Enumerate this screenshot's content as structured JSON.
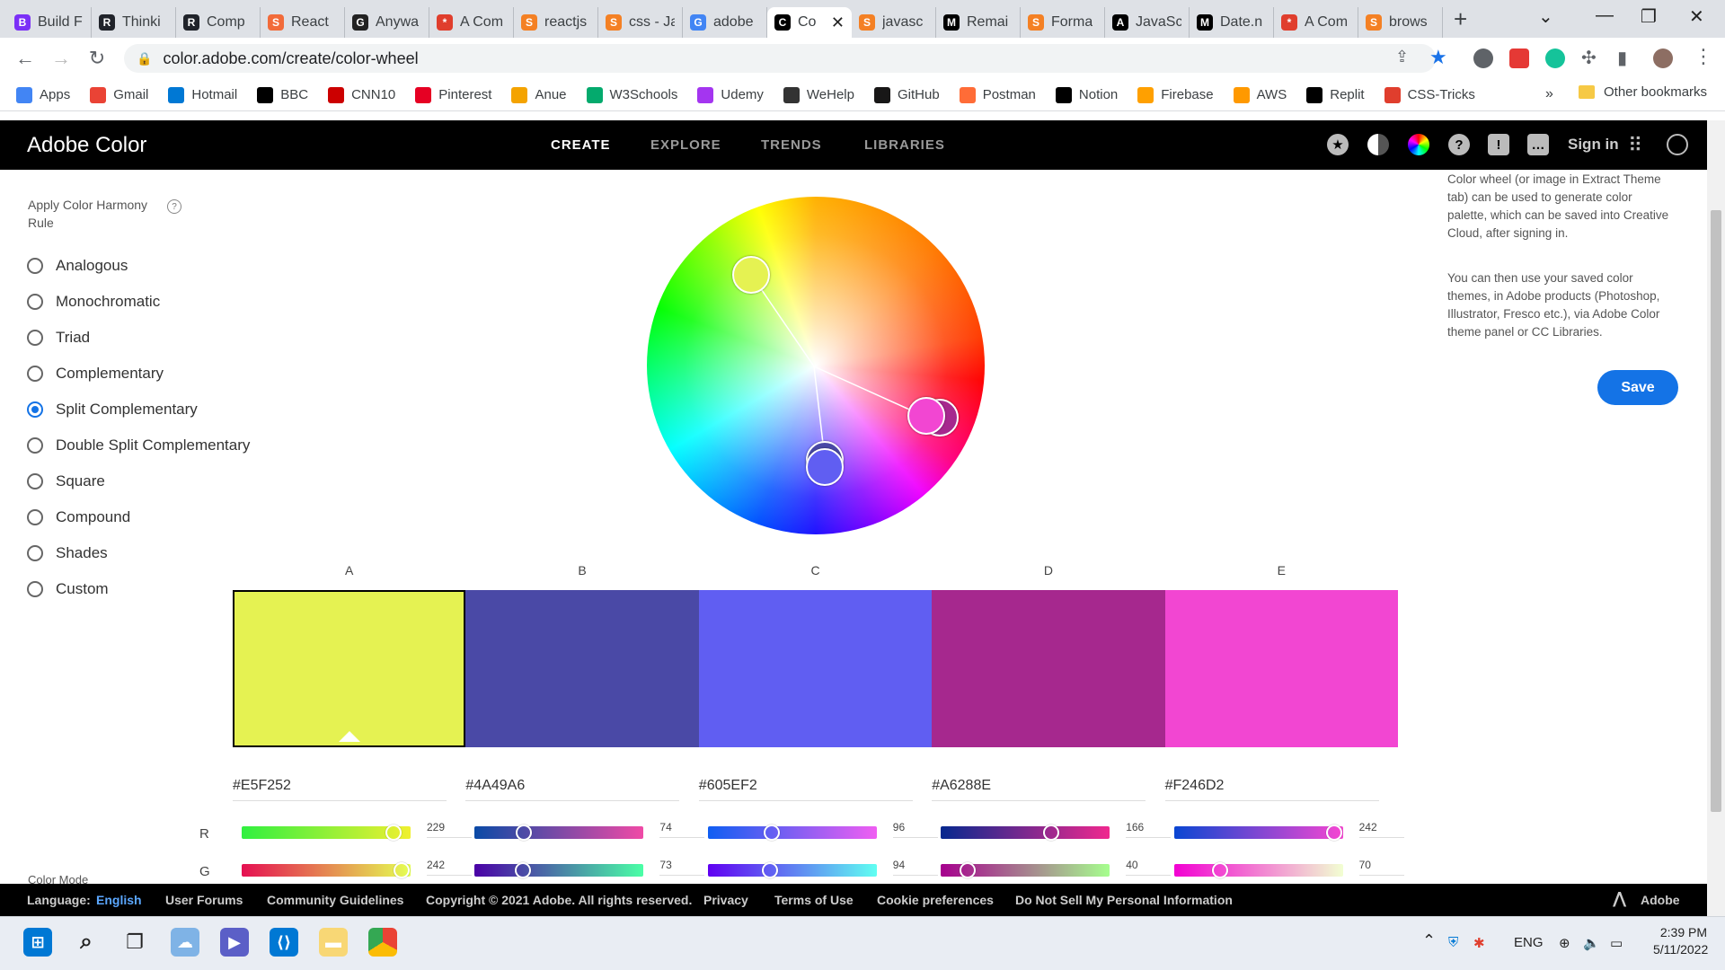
{
  "browser": {
    "tabs": [
      {
        "label": "Build F",
        "color": "#7b2ff7",
        "icon": "B"
      },
      {
        "label": "Thinki",
        "color": "#20232a",
        "icon": "R"
      },
      {
        "label": "Comp",
        "color": "#20232a",
        "icon": "R"
      },
      {
        "label": "React",
        "color": "#f26b3a",
        "icon": "S"
      },
      {
        "label": "Anywa",
        "color": "#222222",
        "icon": "G"
      },
      {
        "label": "A Com",
        "color": "#e03e2d",
        "icon": "*"
      },
      {
        "label": "reactjs",
        "color": "#f48024",
        "icon": "S"
      },
      {
        "label": "css - Ja",
        "color": "#f48024",
        "icon": "S"
      },
      {
        "label": "adobe",
        "color": "#4285f4",
        "icon": "G"
      },
      {
        "label": "Co",
        "color": "#000000",
        "icon": "C",
        "active": true
      },
      {
        "label": "javasc",
        "color": "#f48024",
        "icon": "S"
      },
      {
        "label": "Remai",
        "color": "#000000",
        "icon": "M"
      },
      {
        "label": "Forma",
        "color": "#f48024",
        "icon": "S"
      },
      {
        "label": "JavaSc",
        "color": "#000000",
        "icon": "A"
      },
      {
        "label": "Date.n",
        "color": "#000000",
        "icon": "M"
      },
      {
        "label": "A Com",
        "color": "#e03e2d",
        "icon": "*"
      },
      {
        "label": "brows",
        "color": "#f48024",
        "icon": "S"
      }
    ],
    "url": "color.adobe.com/create/color-wheel",
    "bookmarks": [
      {
        "label": "Apps",
        "color": "#4285f4"
      },
      {
        "label": "Gmail",
        "color": "#ea4335"
      },
      {
        "label": "Hotmail",
        "color": "#0078d4"
      },
      {
        "label": "BBC",
        "color": "#000000"
      },
      {
        "label": "CNN10",
        "color": "#cc0000"
      },
      {
        "label": "Pinterest",
        "color": "#e60023"
      },
      {
        "label": "Anue",
        "color": "#f4a300"
      },
      {
        "label": "W3Schools",
        "color": "#04aa6d"
      },
      {
        "label": "Udemy",
        "color": "#a435f0"
      },
      {
        "label": "WeHelp",
        "color": "#333333"
      },
      {
        "label": "GitHub",
        "color": "#181717"
      },
      {
        "label": "Postman",
        "color": "#ff6c37"
      },
      {
        "label": "Notion",
        "color": "#000000"
      },
      {
        "label": "Firebase",
        "color": "#ffa000"
      },
      {
        "label": "AWS",
        "color": "#ff9900"
      },
      {
        "label": "Replit",
        "color": "#000000"
      },
      {
        "label": "CSS-Tricks",
        "color": "#e03e2d"
      }
    ],
    "bookmarks_more": "»",
    "other_bookmarks": "Other bookmarks"
  },
  "header": {
    "brand": "Adobe Color",
    "nav": [
      "CREATE",
      "EXPLORE",
      "TRENDS",
      "LIBRARIES"
    ],
    "active_nav": "CREATE",
    "signin": "Sign in",
    "icons": [
      "star-icon",
      "contrast-icon",
      "color-wheel-icon",
      "help-icon",
      "feedback-icon",
      "chat-icon",
      "apps-grid-icon",
      "creative-cloud-icon"
    ]
  },
  "harmony": {
    "title": "Apply Color Harmony Rule",
    "help": "?",
    "rules": [
      "Analogous",
      "Monochromatic",
      "Triad",
      "Complementary",
      "Split Complementary",
      "Double Split Complementary",
      "Square",
      "Compound",
      "Shades",
      "Custom"
    ],
    "selected": "Split Complementary",
    "color_mode_label": "Color Mode"
  },
  "palette": {
    "letters": [
      "A",
      "B",
      "C",
      "D",
      "E"
    ],
    "base_index": 0,
    "swatches": [
      {
        "hex": "#E5F252",
        "color": "#E5F252",
        "r": 229,
        "g": 242
      },
      {
        "hex": "#4A49A6",
        "color": "#4A49A6",
        "r": 74,
        "g": 73
      },
      {
        "hex": "#605EF2",
        "color": "#605EF2",
        "r": 96,
        "g": 94
      },
      {
        "hex": "#A6288E",
        "color": "#A6288E",
        "r": 166,
        "g": 40
      },
      {
        "hex": "#F246D2",
        "color": "#F246D2",
        "r": 242,
        "g": 70
      }
    ],
    "channels": [
      "R",
      "G"
    ]
  },
  "info": {
    "p1": "Color wheel (or image in Extract Theme tab) can be used to generate color palette, which can be saved into Creative Cloud, after signing in.",
    "p2": "You can then use your saved color themes, in Adobe products (Photoshop, Illustrator, Fresco etc.), via Adobe Color theme panel or CC Libraries.",
    "save": "Save"
  },
  "footer": {
    "language_label": "Language:",
    "language_value": "English",
    "links": [
      "User Forums",
      "Community Guidelines",
      "Copyright © 2021 Adobe. All rights reserved.",
      "Privacy",
      "Terms of Use",
      "Cookie preferences",
      "Do Not Sell My Personal Information"
    ],
    "adobe": "Adobe"
  },
  "taskbar": {
    "lang": "ENG",
    "time": "2:39 PM",
    "date": "5/11/2022"
  }
}
